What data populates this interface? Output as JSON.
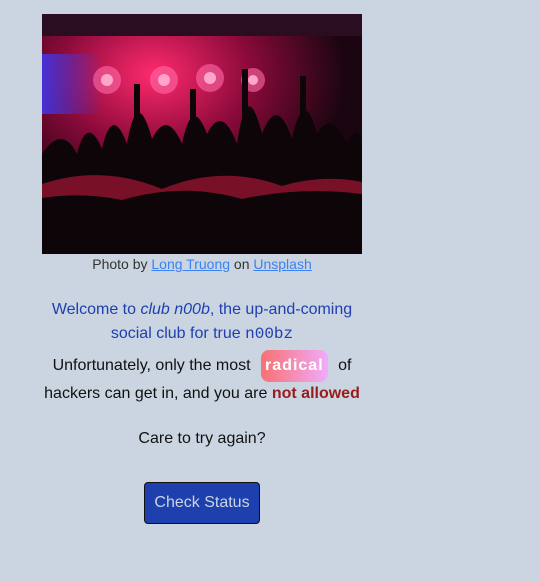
{
  "photo": {
    "alt": "concert crowd under red stage lights"
  },
  "caption": {
    "prefix": "Photo by ",
    "author": "Long Truong",
    "middle": " on ",
    "site": "Unsplash"
  },
  "welcome": {
    "part1": "Welcome to ",
    "club": "club n00b",
    "part2": ", the up-and-coming social club for true ",
    "mono": "n00bz"
  },
  "message": {
    "part1": "Unfortunately, only the most",
    "highlight": "radical",
    "part2": "of hackers can get in, and you are ",
    "status": "not allowed"
  },
  "prompt": "Care to try again?",
  "button": {
    "label": "Check Status"
  }
}
